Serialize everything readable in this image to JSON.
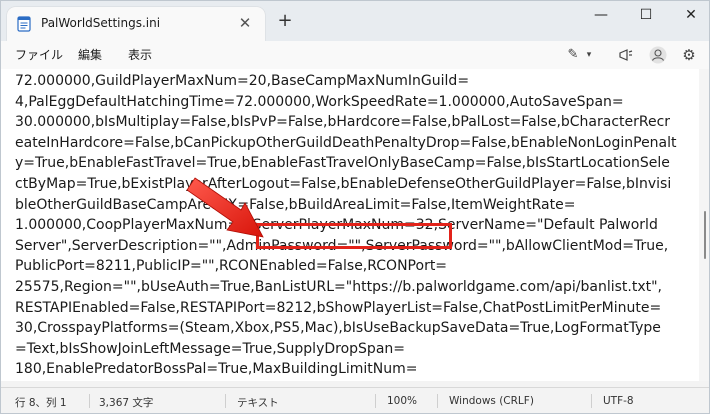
{
  "tab": {
    "title": "PalWorldSettings.ini"
  },
  "menu": {
    "file": "ファイル",
    "edit": "編集",
    "view": "表示"
  },
  "editor_lines": [
    "72.000000,GuildPlayerMaxNum=20,BaseCampMaxNumInGuild=",
    "4,PalEggDefaultHatchingTime=72.000000,WorkSpeedRate=1.000000,AutoSaveSpan=",
    "30.000000,bIsMultiplay=False,bIsPvP=False,bHardcore=False,bPalLost=False,bCharacterRecr",
    "eateInHardcore=False,bCanPickupOtherGuildDeathPenaltyDrop=False,bEnableNonLoginPenalt",
    "y=True,bEnableFastTravel=True,bEnableFastTravelOnlyBaseCamp=False,bIsStartLocationSele",
    "ctByMap=True,bExistPlayerAfterLogout=False,bEnableDefenseOtherGuildPlayer=False,bInvisi",
    "bleOtherGuildBaseCampAreaFX=False,bBuildAreaLimit=False,ItemWeightRate=",
    "1.000000,CoopPlayerMaxNum=4,ServerPlayerMaxNum=32,ServerName=\"Default Palworld",
    "Server\",ServerDescription=\"\",AdminPassword=\"\",ServerPassword=\"\",bAllowClientMod=True,",
    "PublicPort=8211,PublicIP=\"\",RCONEnabled=False,RCONPort=",
    "25575,Region=\"\",bUseAuth=True,BanListURL=\"https://b.palworldgame.com/api/banlist.txt\",",
    "RESTAPIEnabled=False,RESTAPIPort=8212,bShowPlayerList=False,ChatPostLimitPerMinute=",
    "30,CrosspayPlatforms=(Steam,Xbox,PS5,Mac),bIsUseBackupSaveData=True,LogFormatType",
    "=Text,bIsShowJoinLeftMessage=True,SupplyDropSpan=",
    "180,EnablePredatorBossPal=True,MaxBuildingLimitNum="
  ],
  "status": {
    "position": "行 8、列 1",
    "chars": "3,367 文字",
    "mode": "テキスト",
    "zoom": "100%",
    "eol": "Windows (CRLF)",
    "encoding": "UTF-8"
  },
  "colors": {
    "highlight": "#e2231a",
    "background": "#ffffff"
  }
}
